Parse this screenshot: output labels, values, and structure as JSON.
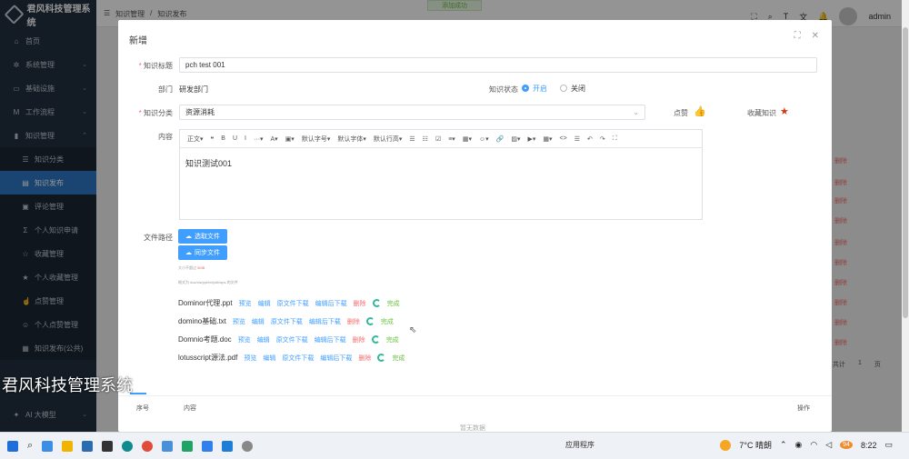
{
  "app": {
    "title": "君风科技管理系统"
  },
  "sidebar": {
    "items": [
      {
        "icon": "home-icon",
        "glyph": "⌂",
        "label": "首页"
      },
      {
        "icon": "gear-icon",
        "glyph": "✲",
        "label": "系统管理"
      },
      {
        "icon": "monitor-icon",
        "glyph": "▭",
        "label": "基础设施"
      },
      {
        "icon": "workflow-icon",
        "glyph": "M",
        "label": "工作流程"
      },
      {
        "icon": "book-icon",
        "glyph": "▮",
        "label": "知识管理"
      }
    ],
    "sub_items": [
      {
        "icon": "list-icon",
        "glyph": "☰",
        "label": "知识分类"
      },
      {
        "icon": "file-icon",
        "glyph": "▤",
        "label": "知识发布"
      },
      {
        "icon": "comment-icon",
        "glyph": "▣",
        "label": "评论管理"
      },
      {
        "icon": "sigma-icon",
        "glyph": "Σ",
        "label": "个人知识申请"
      },
      {
        "icon": "star-outline-icon",
        "glyph": "☆",
        "label": "收藏管理"
      },
      {
        "icon": "star-icon",
        "glyph": "★",
        "label": "个人收藏管理"
      },
      {
        "icon": "thumb-icon",
        "glyph": "☝",
        "label": "点赞管理"
      },
      {
        "icon": "person-thumb-icon",
        "glyph": "☺",
        "label": "个人点赞管理"
      },
      {
        "icon": "public-icon",
        "glyph": "▦",
        "label": "知识发布(公共)"
      }
    ],
    "bottom": {
      "icon": "ai-icon",
      "glyph": "✦",
      "label": "AI 大模型"
    }
  },
  "topbar": {
    "breadcrumb": [
      "知识管理",
      "/",
      "知识发布"
    ],
    "toast": "添加成功",
    "user": "admin"
  },
  "background": {
    "delete_label": "删除",
    "pager_total": "共计",
    "pager_page": "1",
    "pager_unit": "页"
  },
  "dialog": {
    "title": "新增",
    "fields": {
      "title_label": "知识标题",
      "title_value": "pch test 001",
      "dept_label": "部门",
      "dept_value": "研发部门",
      "status_label": "知识状态",
      "status_on": "开启",
      "status_off": "关闭",
      "category_label": "知识分类",
      "category_value": "资源消耗",
      "like_label": "点赞",
      "fav_label": "收藏知识",
      "content_label": "内容",
      "content_value": "知识测试001",
      "path_label": "文件路径"
    },
    "editor_toolbar": [
      "正文▾",
      "❝",
      "B",
      "U",
      "I",
      "···▾",
      "A▾",
      "▣▾",
      "默认字号▾",
      "默认字体▾",
      "默认行高▾",
      "☰",
      "☷",
      "☑",
      "≡▾",
      "▦▾",
      "☺▾",
      "🔗",
      "▨▾",
      "▶▾",
      "▦▾",
      "<>",
      "☰",
      "↶",
      "↷",
      "⛶"
    ],
    "buttons": {
      "select_file": "选取文件",
      "sync_file": "同步文件"
    },
    "hint_size_prefix": "大小不超过",
    "hint_size_value": "5MB",
    "hint_format": "格式为 doc/xls/ppt/txt/pdf/wps 的文件",
    "file_actions": {
      "preview": "预览",
      "edit": "编辑",
      "download_orig": "原文件下载",
      "download_edit": "编辑后下载",
      "delete": "删除",
      "done": "完成"
    },
    "files": [
      {
        "name": "Dominor代理.ppt"
      },
      {
        "name": "domino基础.txt"
      },
      {
        "name": "Domnio考题.doc"
      },
      {
        "name": "lotusscript源法.pdf"
      }
    ],
    "table_headers": {
      "index": "序号",
      "content": "内容",
      "actions": "操作"
    },
    "no_data": "暂无数据"
  },
  "watermark": "君风科技管理系统",
  "taskbar": {
    "app_label": "应用程序",
    "weather": "7°C 晴朗",
    "time": "8:22",
    "badge": "94"
  }
}
